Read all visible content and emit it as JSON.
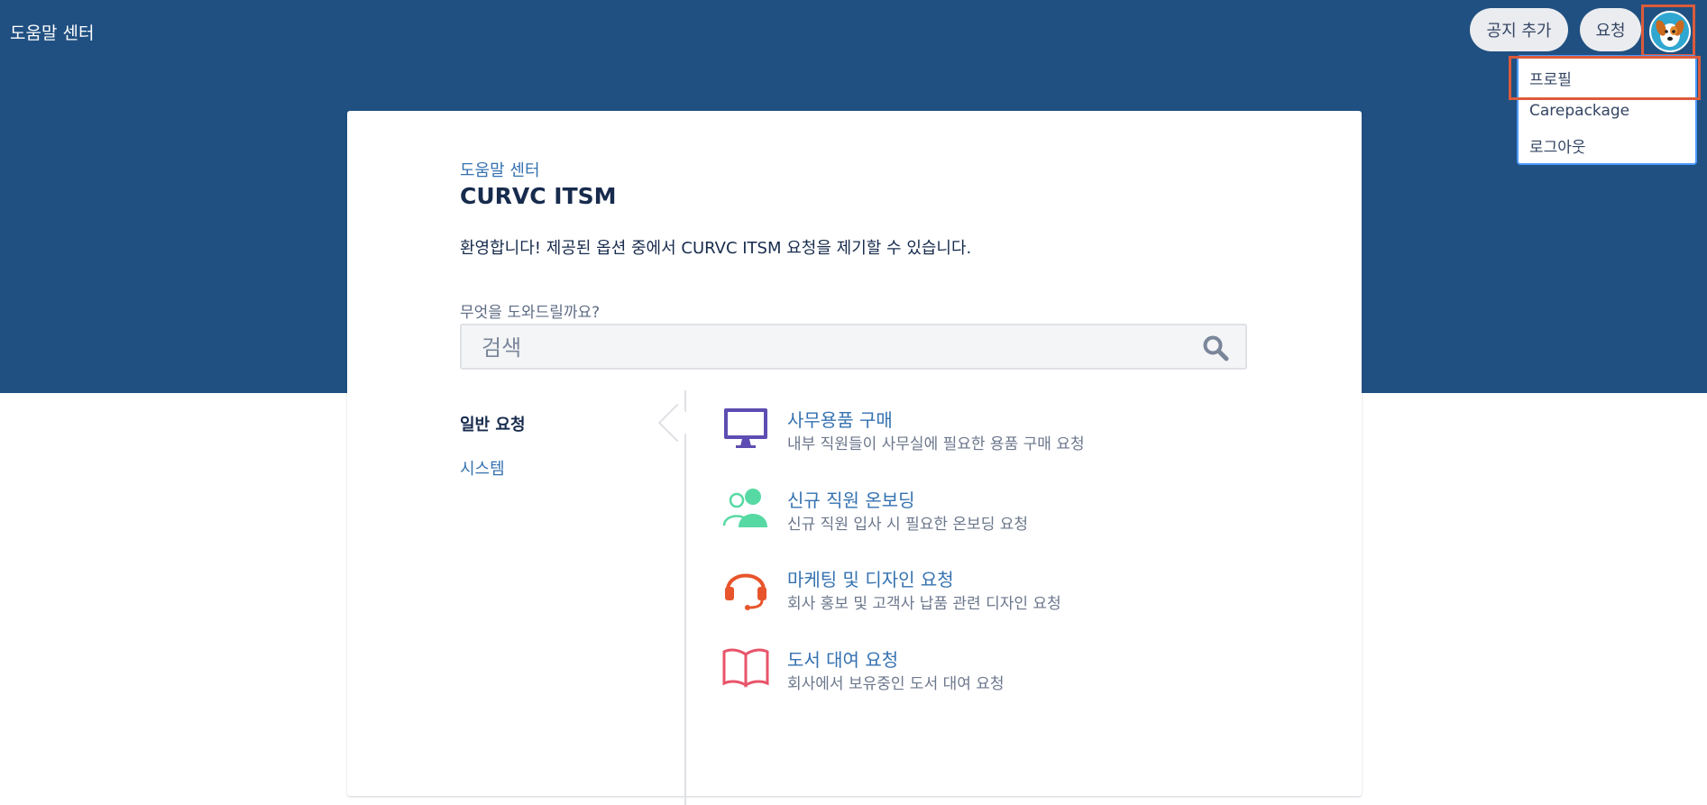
{
  "header": {
    "brand": "도움말 센터",
    "add_notice_label": "공지 추가",
    "requests_label": "요청"
  },
  "profile_menu": {
    "items": [
      {
        "label": "프로필"
      },
      {
        "label": "Carepackage"
      },
      {
        "label": "로그아웃"
      }
    ]
  },
  "main": {
    "breadcrumb": "도움말 센터",
    "title": "CURVC ITSM",
    "welcome": "환영합니다! 제공된 옵션 중에서 CURVC ITSM 요청을 제기할 수 있습니다.",
    "question": "무엇을 도와드릴까요?",
    "search_placeholder": "검색"
  },
  "categories": [
    {
      "label": "일반 요청",
      "active": true
    },
    {
      "label": "시스템",
      "active": false
    }
  ],
  "requests": [
    {
      "title": "사무용품 구매",
      "description": "내부 직원들이 사무실에 필요한 용품 구매 요청",
      "icon": "monitor-icon",
      "color": "#5e4db2"
    },
    {
      "title": "신규 직원 온보딩",
      "description": "신규 직원 입사 시 필요한 온보딩 요청",
      "icon": "people-icon",
      "color": "#57d9a3"
    },
    {
      "title": "마케팅 및 디자인 요청",
      "description": "회사 홍보 및 고객사 납품 관련 디자인 요청",
      "icon": "headset-icon",
      "color": "#e8552c"
    },
    {
      "title": "도서 대여 요청",
      "description": "회사에서 보유중인 도서 대여 요청",
      "icon": "book-icon",
      "color": "#e8546a"
    }
  ],
  "colors": {
    "header_bg": "#205081",
    "link": "#3572b0",
    "highlight_frame": "#dc5b3c"
  }
}
